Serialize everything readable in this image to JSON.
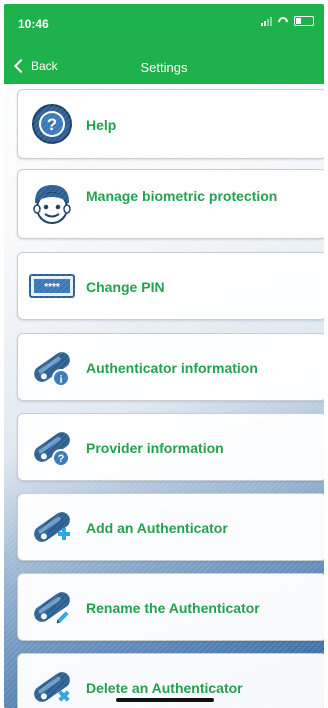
{
  "status": {
    "time": "10:46"
  },
  "nav": {
    "back_label": "Back",
    "title": "Settings"
  },
  "items": [
    {
      "label": "Help",
      "icon": "help-icon"
    },
    {
      "label": "Manage biometric protection",
      "icon": "face-icon"
    },
    {
      "label": "Change PIN",
      "icon": "pin-card-icon"
    },
    {
      "label": "Authenticator information",
      "icon": "authenticator-info-icon"
    },
    {
      "label": "Provider information",
      "icon": "provider-info-icon"
    },
    {
      "label": "Add an Authenticator",
      "icon": "add-authenticator-icon"
    },
    {
      "label": "Rename the Authenticator",
      "icon": "rename-authenticator-icon"
    },
    {
      "label": "Delete an Authenticator",
      "icon": "delete-authenticator-icon"
    }
  ],
  "colors": {
    "header": "#1fb14b",
    "label": "#1e9e4a",
    "icon_blue": "#2d5f93"
  }
}
